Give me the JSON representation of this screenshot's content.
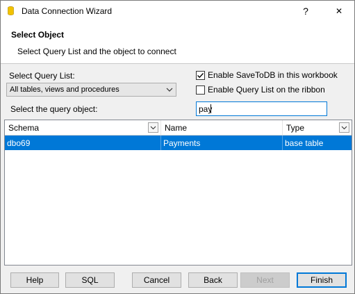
{
  "window": {
    "title": "Data Connection Wizard",
    "help_glyph": "?",
    "close_glyph": "✕"
  },
  "header": {
    "title": "Select Object",
    "subtitle": "Select Query List and the object to connect"
  },
  "form": {
    "query_list_label": "Select Query List:",
    "query_list_value": "All tables, views and procedures",
    "enable_savetodb_label": "Enable SaveToDB in this workbook",
    "enable_savetodb_checked": true,
    "enable_ribbon_label": "Enable Query List on the ribbon",
    "enable_ribbon_checked": false,
    "query_object_label": "Select the query object:",
    "query_object_value": "pay"
  },
  "grid": {
    "columns": [
      "Schema",
      "Name",
      "Type"
    ],
    "rows": [
      {
        "schema": "dbo69",
        "name": "Payments",
        "type": "base table",
        "selected": true
      }
    ]
  },
  "buttons": {
    "help": "Help",
    "sql": "SQL",
    "cancel": "Cancel",
    "back": "Back",
    "next": "Next",
    "finish": "Finish"
  },
  "colors": {
    "accent": "#0078d7",
    "selection_text": "#ffffff"
  }
}
